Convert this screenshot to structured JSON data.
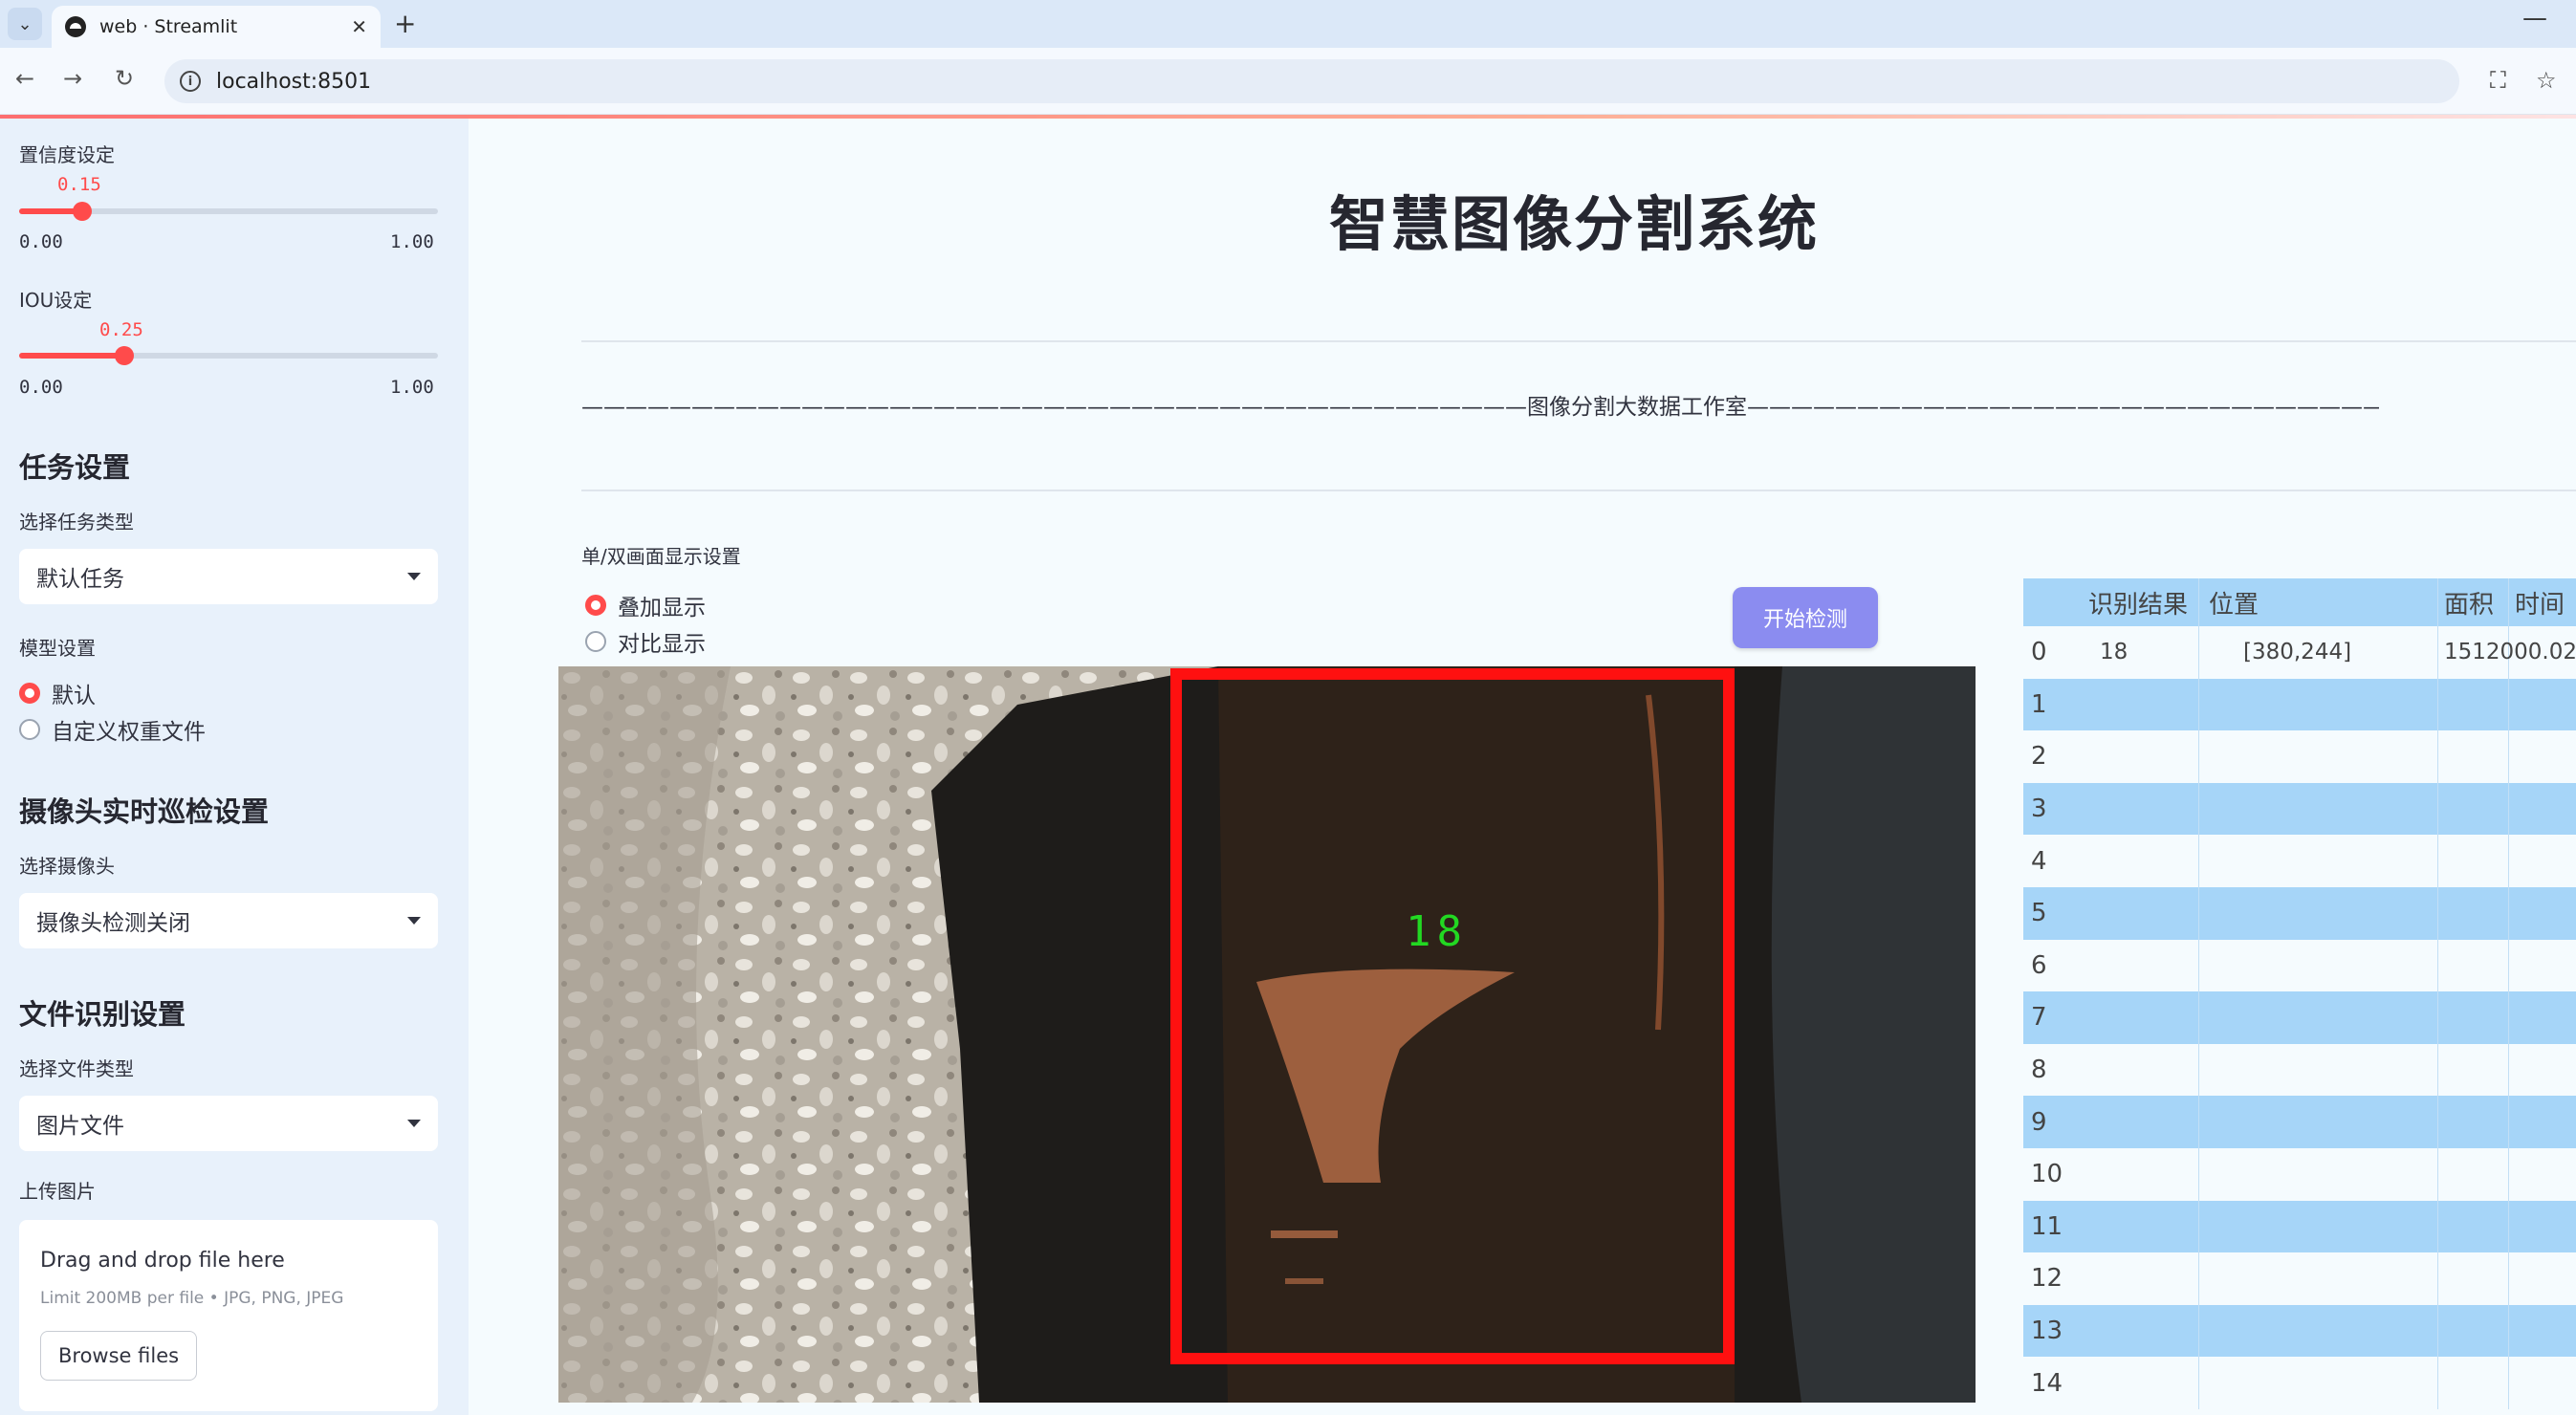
{
  "browser": {
    "tab_title": "web · Streamlit",
    "url": "localhost:8501"
  },
  "sidebar": {
    "confidence": {
      "label": "置信度设定",
      "value": "0.15",
      "min": "0.00",
      "max": "1.00",
      "fraction": 0.15
    },
    "iou": {
      "label": "IOU设定",
      "value": "0.25",
      "min": "0.00",
      "max": "1.00",
      "fraction": 0.25
    },
    "task_heading": "任务设置",
    "task_type_label": "选择任务类型",
    "task_type_value": "默认任务",
    "model_label": "模型设置",
    "model_options": [
      "默认",
      "自定义权重文件"
    ],
    "model_selected": 0,
    "camera_heading": "摄像头实时巡检设置",
    "camera_label": "选择摄像头",
    "camera_value": "摄像头检测关闭",
    "file_heading": "文件识别设置",
    "file_type_label": "选择文件类型",
    "file_type_value": "图片文件",
    "upload_label": "上传图片",
    "upload_title": "Drag and drop file here",
    "upload_limit": "Limit 200MB per file • JPG, PNG, JPEG",
    "browse_label": "Browse files"
  },
  "main": {
    "title": "智慧图像分割系统",
    "subtitle": "———————————————————————————————————————————图像分割大数据工作室——————————————————————————————————————————————————",
    "display_label": "单/双画面显示设置",
    "display_options": [
      "叠加显示",
      "对比显示"
    ],
    "display_selected": 0,
    "detect_button": "开始检测",
    "detection_label": "18"
  },
  "table": {
    "headers": [
      "",
      "识别结果",
      "位置",
      "面积",
      "时间"
    ],
    "rows": [
      [
        "0",
        "18",
        "[380,244]",
        "1512000.02",
        ""
      ],
      [
        "1",
        "",
        "",
        "",
        ""
      ],
      [
        "2",
        "",
        "",
        "",
        ""
      ],
      [
        "3",
        "",
        "",
        "",
        ""
      ],
      [
        "4",
        "",
        "",
        "",
        ""
      ],
      [
        "5",
        "",
        "",
        "",
        ""
      ],
      [
        "6",
        "",
        "",
        "",
        ""
      ],
      [
        "7",
        "",
        "",
        "",
        ""
      ],
      [
        "8",
        "",
        "",
        "",
        ""
      ],
      [
        "9",
        "",
        "",
        "",
        ""
      ],
      [
        "10",
        "",
        "",
        "",
        ""
      ],
      [
        "11",
        "",
        "",
        "",
        ""
      ],
      [
        "12",
        "",
        "",
        "",
        ""
      ],
      [
        "13",
        "",
        "",
        "",
        ""
      ],
      [
        "14",
        "",
        "",
        "",
        ""
      ]
    ]
  },
  "colors": {
    "accent": "#ff4b4b",
    "button": "#8b8cf0",
    "table_stripe": "#a6d5f8",
    "box": "#ff1010",
    "label": "#22d822"
  }
}
